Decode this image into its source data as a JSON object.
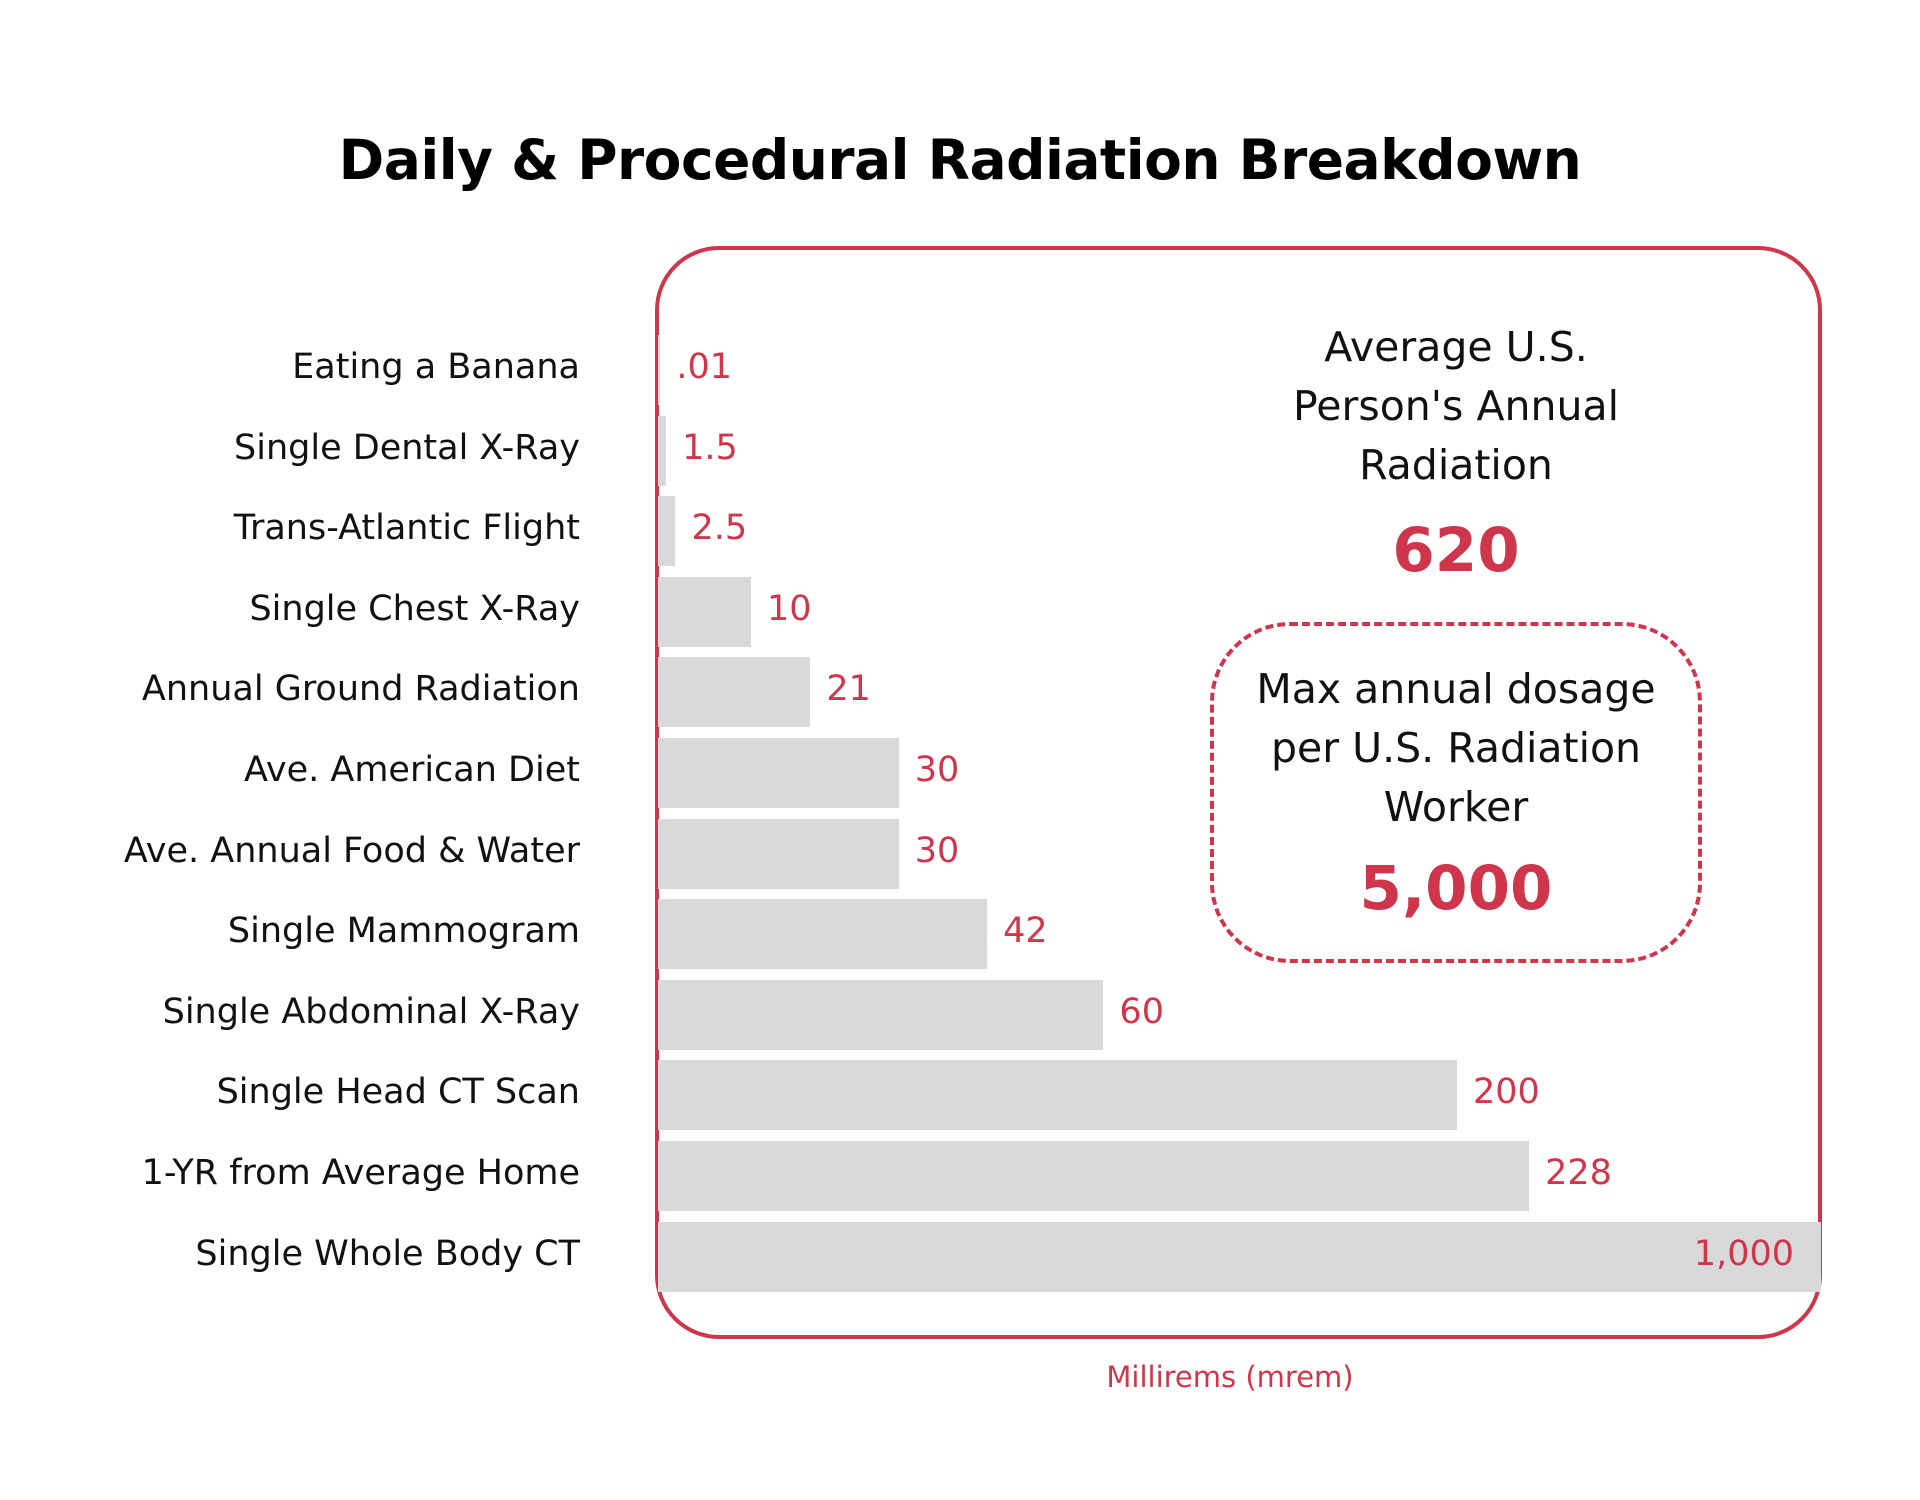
{
  "chart_data": {
    "type": "bar",
    "orientation": "horizontal",
    "title": "Daily & Procedural Radiation Breakdown",
    "xlabel": "Millirems (mrem)",
    "ylabel": "",
    "grid": false,
    "categories": [
      "Eating a Banana",
      "Single Dental X-Ray",
      "Trans-Atlantic Flight",
      "Single Chest X-Ray",
      "Annual Ground Radiation",
      "Ave. American Diet",
      "Ave. Annual Food & Water",
      "Single Mammogram",
      "Single Abdominal X-Ray",
      "Single Head CT Scan",
      "1-YR from Average Home",
      "Single Whole Body CT"
    ],
    "values": [
      0.01,
      1.5,
      2.5,
      10,
      21,
      30,
      30,
      42,
      60,
      200,
      228,
      1000
    ],
    "value_labels": [
      ".01",
      "1.5",
      "2.5",
      "10",
      "21",
      "30",
      "30",
      "42",
      "60",
      "200",
      "228",
      "1,000"
    ],
    "display_fraction": [
      0.2,
      0.7,
      1.5,
      8.0,
      13.1,
      20.7,
      20.7,
      28.3,
      38.3,
      68.7,
      74.9,
      100
    ],
    "bar_color": "#d9d9d9",
    "value_color": "#d0364b",
    "annotations": [
      {
        "label": "Average U.S. Person's Annual Radiation",
        "label_lines": [
          "Average U.S.",
          "Person's Annual",
          "Radiation"
        ],
        "value": 620,
        "value_label": "620"
      },
      {
        "label": "Max annual dosage per U.S. Radiation Worker",
        "label_lines": [
          "Max annual dosage",
          "per U.S. Radiation",
          "Worker"
        ],
        "value": 5000,
        "value_label": "5,000"
      }
    ]
  },
  "colors": {
    "accent": "#d0364b",
    "bar": "#d9d9d9",
    "text": "#111111"
  }
}
